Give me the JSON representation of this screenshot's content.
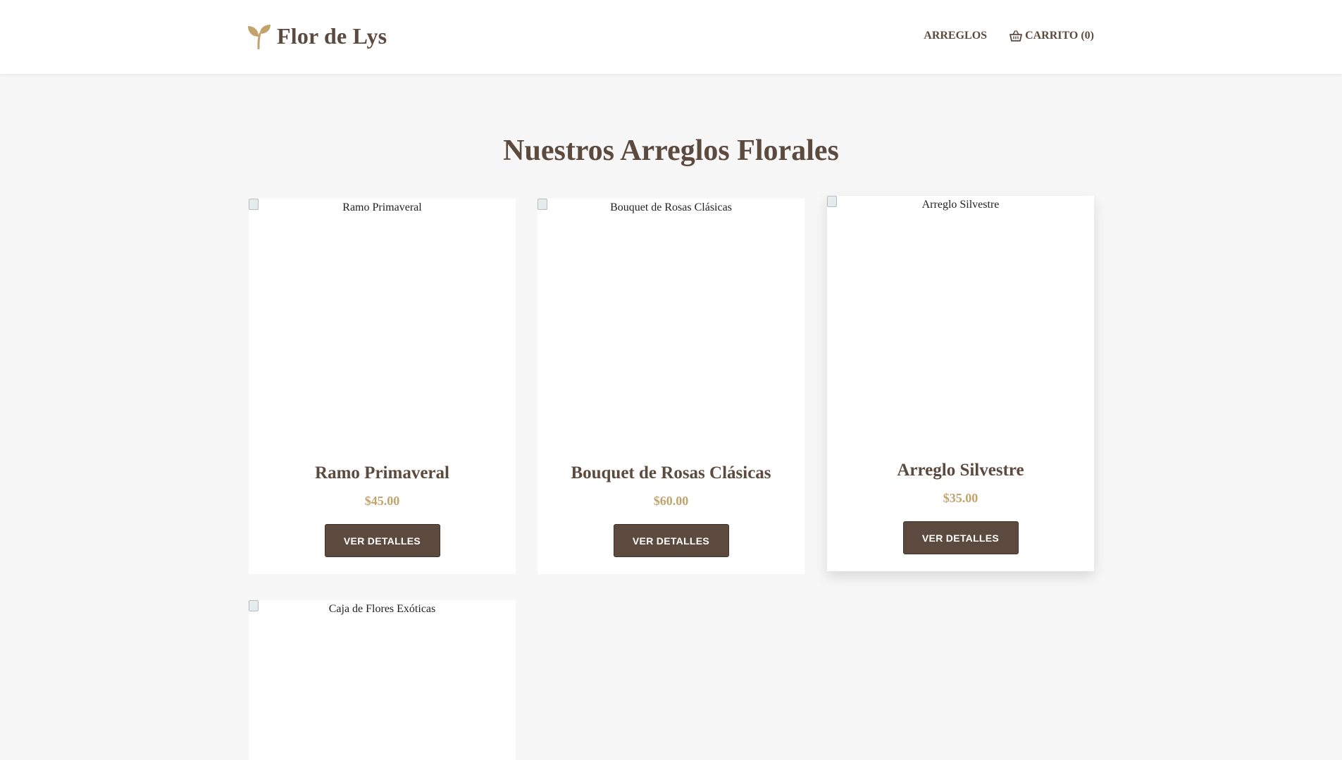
{
  "header": {
    "brand": "Flor de Lys",
    "logo_icon": "sprout-icon",
    "nav": {
      "arreglos_label": "ARREGLOS",
      "cart_label": "CARRITO (0)",
      "cart_icon": "basket-icon"
    }
  },
  "main": {
    "title": "Nuestros Arreglos Florales",
    "products": [
      {
        "image_alt": "Ramo Primaveral",
        "name": "Ramo Primaveral",
        "price": "$45.00",
        "button": "VER DETALLES"
      },
      {
        "image_alt": "Bouquet de Rosas Clásicas",
        "name": "Bouquet de Rosas Clásicas",
        "price": "$60.00",
        "button": "VER DETALLES"
      },
      {
        "image_alt": "Arreglo Silvestre",
        "name": "Arreglo Silvestre",
        "price": "$35.00",
        "button": "VER DETALLES"
      },
      {
        "image_alt": "Caja de Flores Exóticas"
      }
    ]
  },
  "colors": {
    "brand_brown": "#5d4a3f",
    "accent_gold": "#c2a36b",
    "background": "#f7f7f7"
  }
}
